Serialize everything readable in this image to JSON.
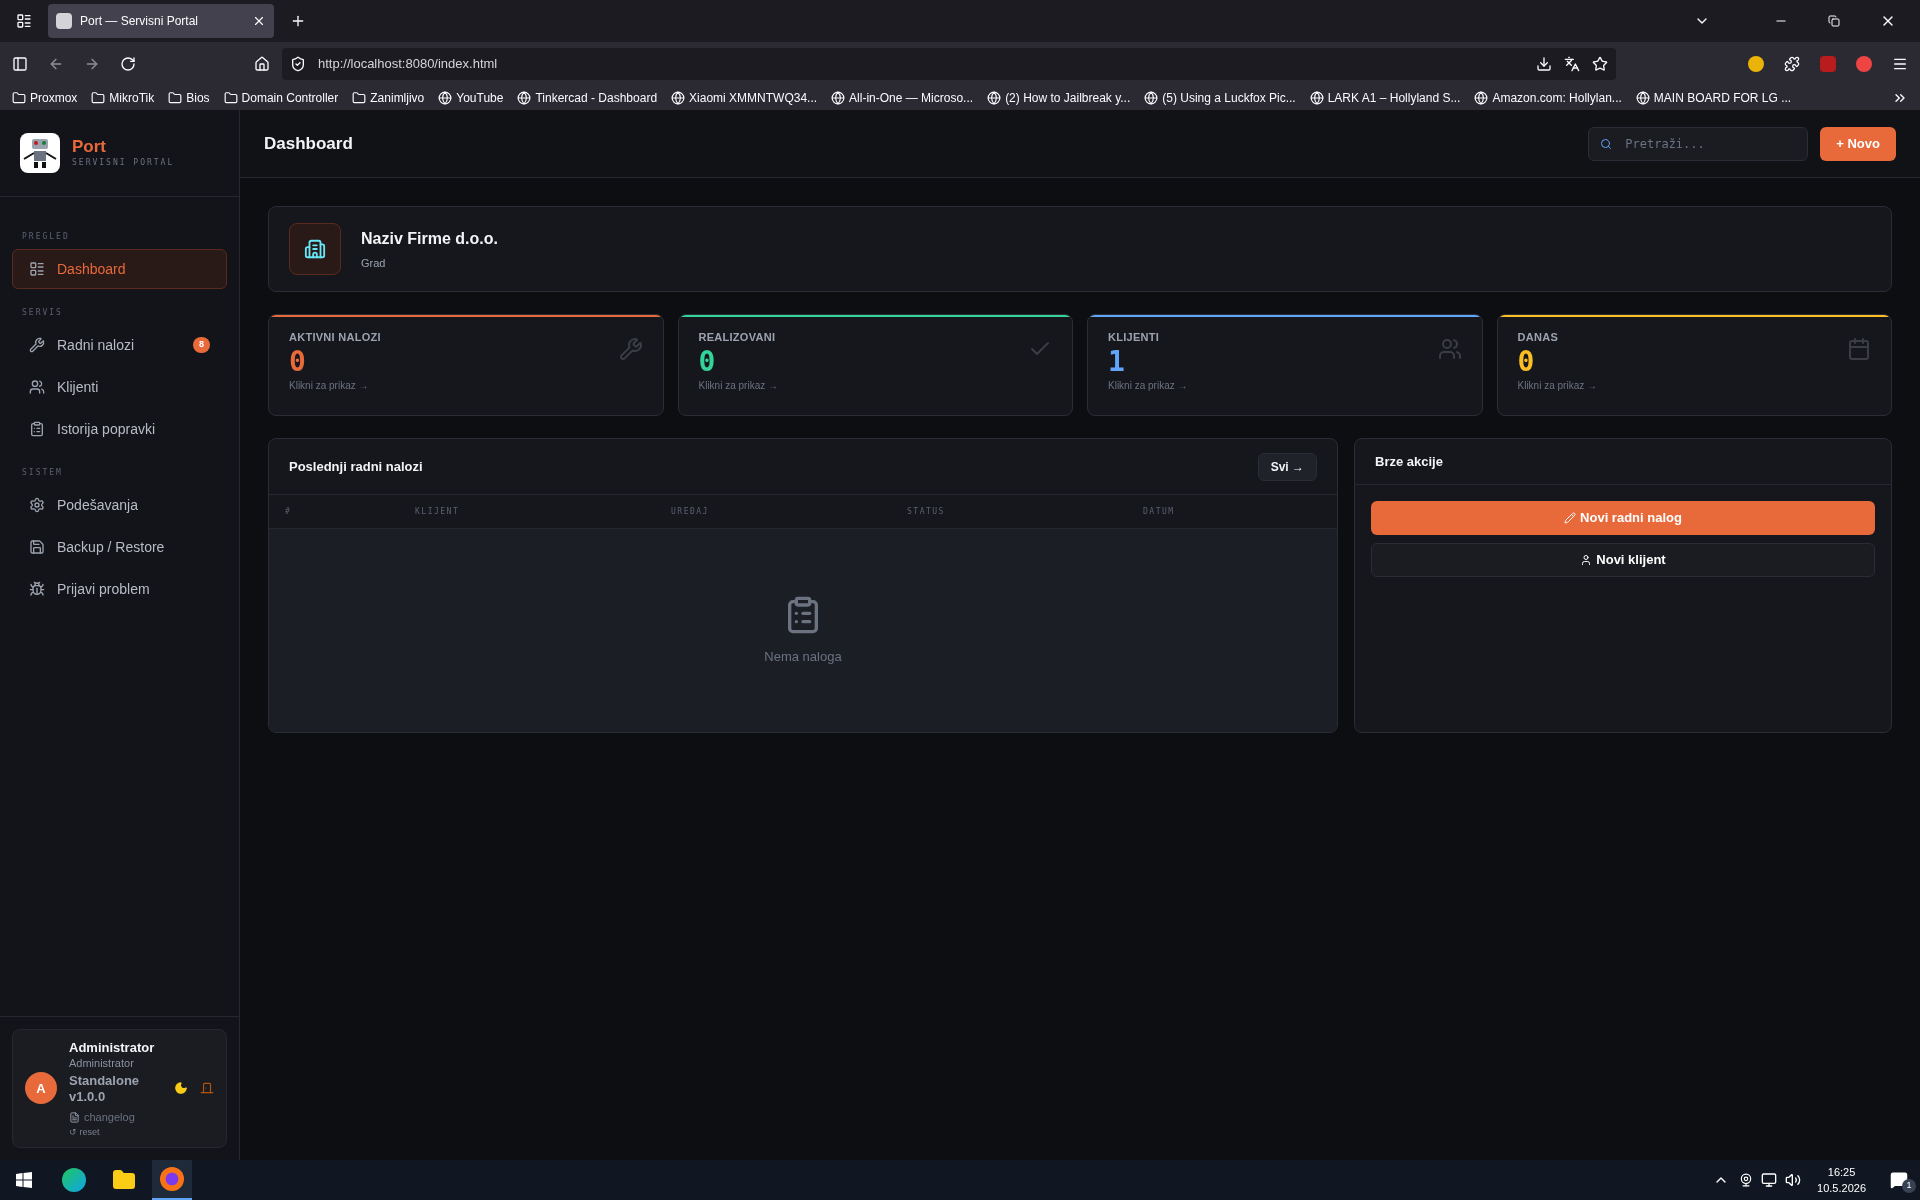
{
  "browser": {
    "tabs": [
      {
        "title": "Port — Servisni Portal",
        "selected": true
      }
    ],
    "url": "http://localhost:8080/index.html",
    "bookmarks": [
      {
        "label": "Proxmox",
        "kind": "folder"
      },
      {
        "label": "MikroTik",
        "kind": "folder"
      },
      {
        "label": "Bios",
        "kind": "folder"
      },
      {
        "label": "Domain Controller",
        "kind": "folder"
      },
      {
        "label": "Zanimljivo",
        "kind": "folder"
      },
      {
        "label": "YouTube",
        "kind": "site"
      },
      {
        "label": "Tinkercad - Dashboard",
        "kind": "site"
      },
      {
        "label": "Xiaomi XMMNTWQ34...",
        "kind": "site"
      },
      {
        "label": "All-in-One — Microso...",
        "kind": "site"
      },
      {
        "label": "(2) How to Jailbreak y...",
        "kind": "site"
      },
      {
        "label": "(5) Using a Luckfox Pic...",
        "kind": "site"
      },
      {
        "label": "LARK A1 – Hollyland S...",
        "kind": "site"
      },
      {
        "label": "Amazon.com: Hollylan...",
        "kind": "site"
      },
      {
        "label": "MAIN BOARD FOR LG ...",
        "kind": "site"
      }
    ]
  },
  "sidebar": {
    "brand": {
      "name": "Port",
      "subtitle": "SERVISNI PORTAL"
    },
    "sections": [
      {
        "title": "PREGLED",
        "items": [
          {
            "label": "Dashboard",
            "selected": true
          }
        ]
      },
      {
        "title": "SERVIS",
        "items": [
          {
            "label": "Radni nalozi",
            "selected": false,
            "badge": "8"
          },
          {
            "label": "Klijenti",
            "selected": false
          },
          {
            "label": "Istorija popravki",
            "selected": false
          }
        ]
      },
      {
        "title": "SISTEM",
        "items": [
          {
            "label": "Podešavanja",
            "selected": false
          },
          {
            "label": "Backup / Restore",
            "selected": false
          },
          {
            "label": "Prijavi problem",
            "selected": false
          }
        ]
      }
    ],
    "user": {
      "avatar": "A",
      "name": "Administrator",
      "role": "Administrator",
      "version": "Standalone v1.0.0",
      "changelog": "changelog",
      "reset": "↺ reset"
    }
  },
  "header": {
    "title": "Dashboard",
    "search_placeholder": "Pretraži...",
    "new_button": "+ Novo"
  },
  "company": {
    "name": "Naziv Firme d.o.o.",
    "city": "Grad"
  },
  "stats": [
    {
      "label": "AKTIVNI NALOZI",
      "value": "0",
      "link": "Klikni za prikaz →",
      "color": "#e8693a"
    },
    {
      "label": "REALIZOVANI",
      "value": "0",
      "link": "Klikni za prikaz →",
      "color": "#34d399"
    },
    {
      "label": "KLIJENTI",
      "value": "1",
      "link": "Klikni za prikaz →",
      "color": "#60a5fa"
    },
    {
      "label": "DANAS",
      "value": "0",
      "link": "Klikni za prikaz →",
      "color": "#fbbf24"
    }
  ],
  "recent": {
    "title": "Poslednji radni nalozi",
    "all_button": "Svi →",
    "columns": [
      "#",
      "KLIJENT",
      "UREĐAJ",
      "STATUS",
      "DATUM"
    ],
    "empty_text": "Nema naloga"
  },
  "quick": {
    "title": "Brze akcije",
    "actions": [
      {
        "label": "Novi radni nalog",
        "kind": "primary"
      },
      {
        "label": "Novi klijent",
        "kind": "secondary"
      }
    ]
  },
  "taskbar": {
    "time": "16:25",
    "date": "10.5.2026",
    "notifications": "1"
  }
}
